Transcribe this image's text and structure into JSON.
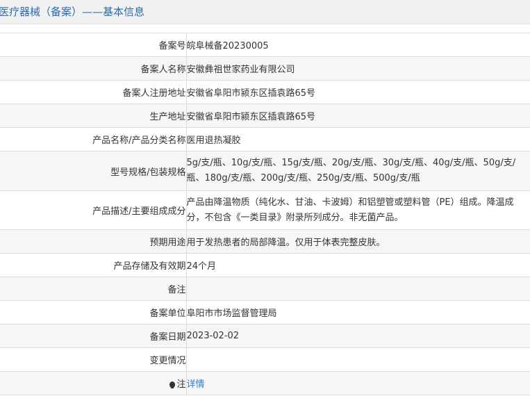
{
  "page_title": "医疗器械（备案）——基本信息",
  "rows": [
    {
      "label": "备案号",
      "value": "皖阜械备20230005"
    },
    {
      "label": "备案人名称",
      "value": "安徽彝祖世家药业有限公司"
    },
    {
      "label": "备案人注册地址",
      "value": "安徽省阜阳市颍东区插袁路65号"
    },
    {
      "label": "生产地址",
      "value": "安徽省阜阳市颍东区插袁路65号"
    },
    {
      "label": "产品名称/产品分类名称",
      "value": "医用退热凝胶"
    },
    {
      "label": "型号规格/包装规格",
      "value": "5g/支/瓶、10g/支/瓶、15g/支/瓶、20g/支/瓶、30g/支/瓶、40g/支/瓶、50g/支/瓶、180g/支/瓶、200g/支/瓶、250g/支/瓶、500g/支/瓶"
    },
    {
      "label": "产品描述/主要组成成分",
      "value": "产品由降温物质（纯化水、甘油、卡波姆）和铝塑管或塑料管（PE）组成。降温成分，不包含《一类目录》附录所列成分。非无菌产品。"
    },
    {
      "label": "预期用途",
      "value": "用于发热患者的局部降温。仅用于体表完整皮肤。"
    },
    {
      "label": "产品存储及有效期",
      "value": "24个月"
    },
    {
      "label": "备注",
      "value": ""
    },
    {
      "label": "备案单位",
      "value": "阜阳市市场监督管理局"
    },
    {
      "label": "备案日期",
      "value": "2023-02-02"
    },
    {
      "label": "变更情况",
      "value": ""
    },
    {
      "label": "注",
      "value": "详情"
    }
  ]
}
